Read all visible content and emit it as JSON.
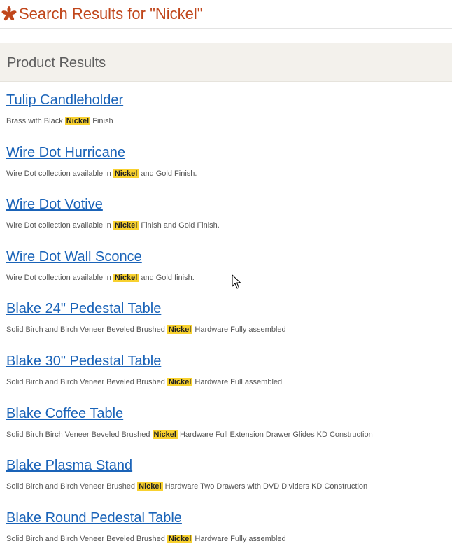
{
  "header": {
    "title": "Search Results for \"Nickel\"",
    "logo_icon": "flower-icon",
    "title_color": "#c0461b"
  },
  "section": {
    "title": "Product Results"
  },
  "highlight_color": "#f8d12f",
  "link_color": "#1a63b8",
  "results": [
    {
      "title": "Tulip Candleholder",
      "desc_before": "Brass with Black",
      "term": "Nickel",
      "desc_after": "Finish"
    },
    {
      "title": "Wire Dot Hurricane",
      "desc_before": "Wire Dot collection available in",
      "term": "Nickel",
      "desc_after": "and Gold Finish."
    },
    {
      "title": "Wire Dot Votive",
      "desc_before": "Wire Dot collection available in",
      "term": "Nickel",
      "desc_after": "Finish and Gold Finish."
    },
    {
      "title": "Wire Dot Wall Sconce",
      "desc_before": "Wire Dot collection available in",
      "term": "Nickel",
      "desc_after": "and Gold finish."
    },
    {
      "title": "Blake 24\" Pedestal Table",
      "desc_before": "Solid Birch and Birch Veneer Beveled Brushed",
      "term": "Nickel",
      "desc_after": "Hardware Fully assembled"
    },
    {
      "title": "Blake 30\" Pedestal Table",
      "desc_before": "Solid Birch and Birch Veneer Beveled Brushed",
      "term": "Nickel",
      "desc_after": "Hardware Full assembled"
    },
    {
      "title": "Blake Coffee Table",
      "desc_before": "Solid Birch Birch Veneer Beveled Brushed",
      "term": "Nickel",
      "desc_after": "Hardware Full Extension Drawer Glides KD Construction"
    },
    {
      "title": "Blake Plasma Stand",
      "desc_before": "Solid Birch and Birch Veneer Brushed",
      "term": "Nickel",
      "desc_after": "Hardware Two Drawers with DVD Dividers KD Construction"
    },
    {
      "title": "Blake Round Pedestal Table",
      "desc_before": "Solid Birch and Birch Veneer Beveled Brushed",
      "term": "Nickel",
      "desc_after": "Hardware Fully assembled"
    }
  ]
}
